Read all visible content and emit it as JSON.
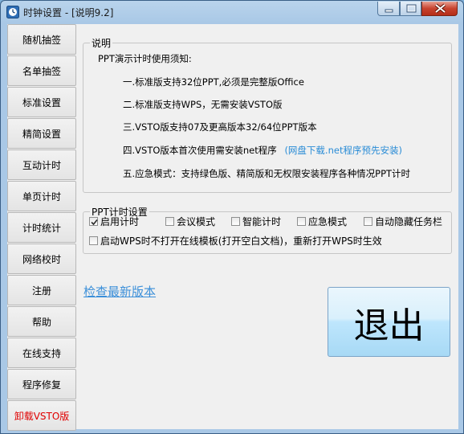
{
  "window": {
    "title": "时钟设置 - [说明9.2]"
  },
  "sidebar": {
    "items": [
      {
        "label": "随机抽签"
      },
      {
        "label": "名单抽签"
      },
      {
        "label": "标准设置"
      },
      {
        "label": "精简设置"
      },
      {
        "label": "互动计时"
      },
      {
        "label": "单页计时"
      },
      {
        "label": "计时统计"
      },
      {
        "label": "网络校时"
      },
      {
        "label": "注册"
      },
      {
        "label": "帮助"
      },
      {
        "label": "在线支持"
      },
      {
        "label": "程序修复"
      },
      {
        "label": "卸载VSTO版"
      }
    ]
  },
  "info": {
    "legend": "说明",
    "heading": "PPT演示计时使用须知:",
    "lines": [
      "一.标准版支持32位PPT,必须是完整版Office",
      "二.标准版支持WPS，无需安装VSTO版",
      "三.VSTO版支持07及更高版本32/64位PPT版本",
      "四.VSTO版本首次使用需安装net程序",
      "五.应急模式：支持绿色版、精简版和无权限安装程序各种情况PPT计时"
    ],
    "link": "(网盘下载.net程序预先安装)"
  },
  "options": {
    "legend": "PPT计时设置",
    "checkboxes": [
      {
        "label": "启用计时",
        "checked": true
      },
      {
        "label": "会议模式",
        "checked": false
      },
      {
        "label": "智能计时",
        "checked": false
      },
      {
        "label": "应急模式",
        "checked": false
      },
      {
        "label": "自动隐藏任务栏",
        "checked": false
      },
      {
        "label": "启动WPS时不打开在线模板(打开空白文档)，重新打开WPS时生效",
        "checked": false
      }
    ]
  },
  "update_link": "检查最新版本",
  "exit_label": "退出",
  "colors": {
    "link": "#2a8cd6",
    "danger": "#e00000",
    "close": "#c7432f"
  }
}
